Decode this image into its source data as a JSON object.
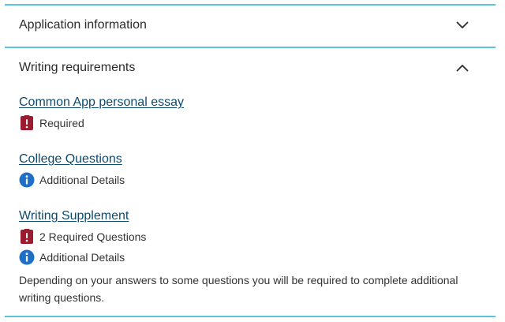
{
  "sections": {
    "application": {
      "title": "Application information",
      "state": "collapsed",
      "icon": "chevron-down-icon"
    },
    "writing": {
      "title": "Writing requirements",
      "state": "expanded",
      "icon": "chevron-up-icon"
    }
  },
  "writing_items": [
    {
      "link": "Common App personal essay",
      "badges": [
        {
          "icon": "required-alert-icon",
          "text": "Required"
        }
      ]
    },
    {
      "link": "College Questions",
      "badges": [
        {
          "icon": "info-circle-icon",
          "text": "Additional Details"
        }
      ]
    },
    {
      "link": "Writing Supplement",
      "badges": [
        {
          "icon": "required-alert-icon",
          "text": "2 Required Questions"
        },
        {
          "icon": "info-circle-icon",
          "text": "Additional Details"
        }
      ],
      "note": "Depending on your answers to some questions you will be required to complete additional writing questions."
    }
  ],
  "colors": {
    "rule": "#5cc4e0",
    "link": "#0b4a6f",
    "required": "#9b1b30",
    "info": "#1f6fc7"
  }
}
